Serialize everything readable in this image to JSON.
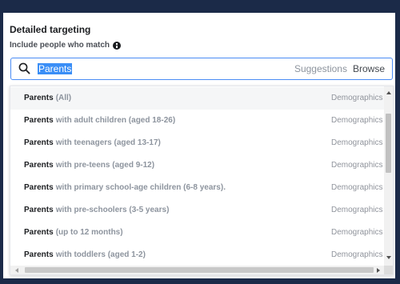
{
  "header": {
    "title": "Detailed targeting",
    "subtitle": "Include people who match",
    "info_icon": "info-icon"
  },
  "search": {
    "icon": "search-icon",
    "value": "Parents",
    "suggestions_label": "Suggestions",
    "browse_label": "Browse"
  },
  "results": [
    {
      "name": "Parents",
      "detail": "(All)",
      "category": "Demographics"
    },
    {
      "name": "Parents",
      "detail": "with adult children (aged 18-26)",
      "category": "Demographics"
    },
    {
      "name": "Parents",
      "detail": "with teenagers (aged 13-17)",
      "category": "Demographics"
    },
    {
      "name": "Parents",
      "detail": "with pre-teens (aged 9-12)",
      "category": "Demographics"
    },
    {
      "name": "Parents",
      "detail": "with primary school-age children (6-8 years).",
      "category": "Demographics"
    },
    {
      "name": "Parents",
      "detail": "with pre-schoolers (3-5 years)",
      "category": "Demographics"
    },
    {
      "name": "Parents",
      "detail": "(up to 12 months)",
      "category": "Demographics"
    },
    {
      "name": "Parents",
      "detail": "with toddlers (aged 1-2)",
      "category": "Demographics"
    }
  ],
  "colors": {
    "frame": "#1b2a48",
    "search_border": "#4a8cf5",
    "selection": "#3a8ef6",
    "hover_row": "#f5f6f7",
    "muted_text": "#8d949e"
  }
}
